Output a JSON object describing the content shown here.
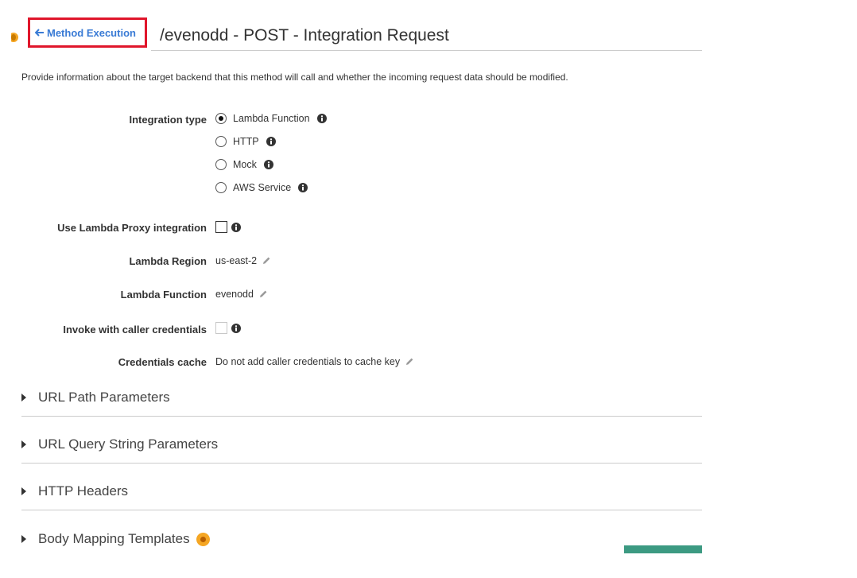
{
  "header": {
    "back_link": "Method Execution",
    "title": "/evenodd - POST - Integration Request"
  },
  "description": "Provide information about the target backend that this method will call and whether the incoming request data should be modified.",
  "integration_type": {
    "label": "Integration type",
    "options": [
      {
        "label": "Lambda Function",
        "selected": true
      },
      {
        "label": "HTTP",
        "selected": false
      },
      {
        "label": "Mock",
        "selected": false
      },
      {
        "label": "AWS Service",
        "selected": false
      }
    ]
  },
  "lambda_proxy": {
    "label": "Use Lambda Proxy integration",
    "checked": false
  },
  "lambda_region": {
    "label": "Lambda Region",
    "value": "us-east-2"
  },
  "lambda_function": {
    "label": "Lambda Function",
    "value": "evenodd"
  },
  "invoke_caller": {
    "label": "Invoke with caller credentials",
    "checked": false
  },
  "credentials_cache": {
    "label": "Credentials cache",
    "value": "Do not add caller credentials to cache key"
  },
  "sections": [
    {
      "label": "URL Path Parameters"
    },
    {
      "label": "URL Query String Parameters"
    },
    {
      "label": "HTTP Headers"
    },
    {
      "label": "Body Mapping Templates"
    }
  ],
  "colors": {
    "highlight_border": "#e0162b",
    "link": "#3a7bd5",
    "accent_orange": "#f5a623",
    "button_green": "#3c9a82"
  }
}
